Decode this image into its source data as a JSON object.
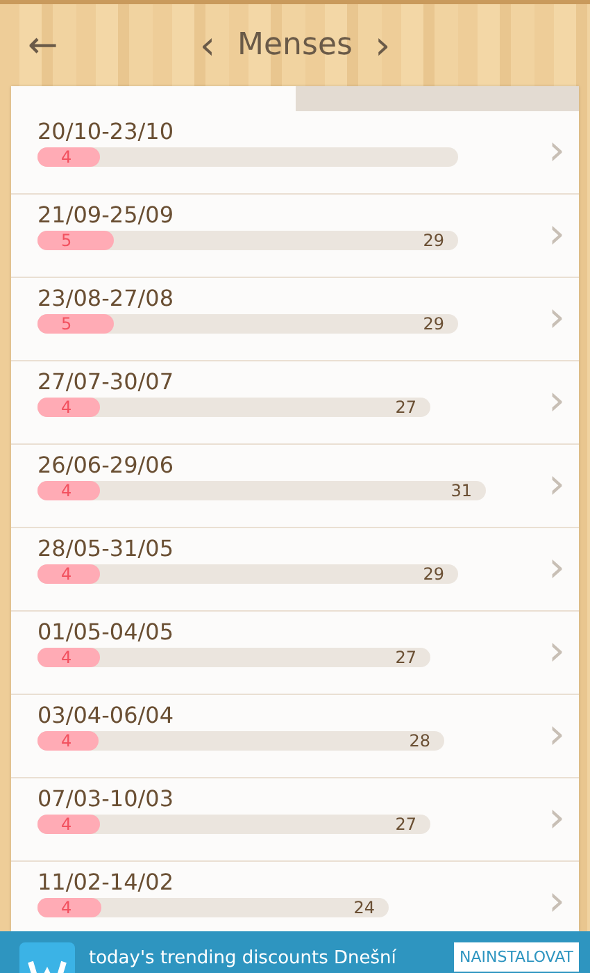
{
  "header": {
    "back": "←",
    "prev": "‹",
    "title": "Menses",
    "next": "›"
  },
  "rows": [
    {
      "dates": "20/10-23/10",
      "period": "4",
      "period_level": {
        "level": 0.15
      },
      "chevron": "›"
    },
    {
      "dates": "21/09-25/09",
      "period": "5",
      "cycle": "29",
      "period_level": {
        "level": 0.18
      },
      "chevron": "›"
    },
    {
      "dates": "23/08-27/08",
      "period": "5",
      "cycle": "29",
      "period_level": {
        "level": 0.18
      },
      "chevron": "›"
    },
    {
      "dates": "27/07-30/07",
      "period": "4",
      "cycle": "27",
      "period_level": {
        "level": 0.16
      },
      "chevron": "›"
    },
    {
      "dates": "26/06-29/06",
      "period": "4",
      "cycle": "31",
      "period_level": {
        "level": 0.14
      },
      "chevron": "›"
    },
    {
      "dates": "28/05-31/05",
      "period": "4",
      "cycle": "29",
      "period_level": {
        "level": 0.15
      },
      "chevron": "›"
    },
    {
      "dates": "01/05-04/05",
      "period": "4",
      "cycle": "27",
      "period_level": {
        "level": 0.16
      },
      "chevron": "›"
    },
    {
      "dates": "03/04-06/04",
      "period": "4",
      "cycle": "28",
      "period_level": {
        "level": 0.15
      },
      "chevron": "›"
    },
    {
      "dates": "07/03-10/03",
      "period": "4",
      "cycle": "27",
      "period_level": {
        "level": 0.16
      },
      "chevron": "›"
    },
    {
      "dates": "11/02-14/02",
      "period": "4",
      "cycle": "24",
      "period_level": {
        "level": 0.18
      },
      "chevron": "›"
    }
  ],
  "ad": {
    "text": "today's trending discounts Dnešní",
    "button": "NAINSTALOVAT"
  }
}
